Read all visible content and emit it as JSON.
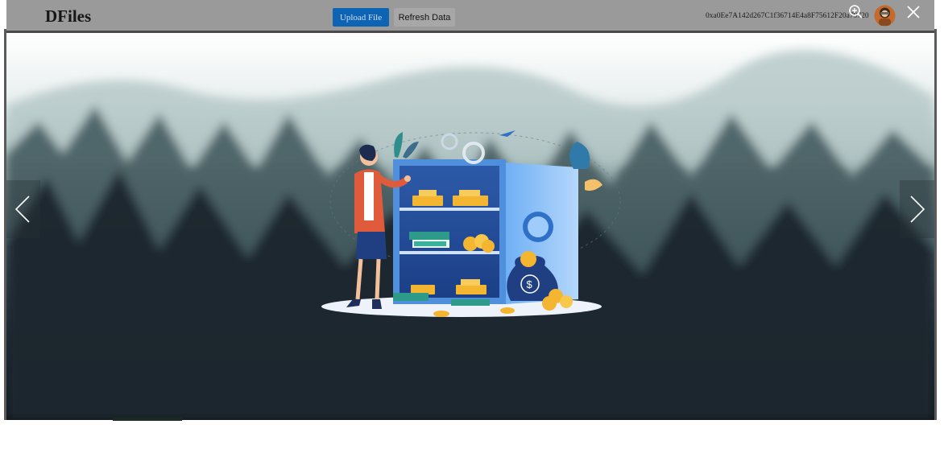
{
  "header": {
    "logo_text": "DFiles",
    "upload_label": "Upload File",
    "refresh_label": "Refresh Data",
    "wallet_address": "0xa0Ee7A142d267C1f36714E4a8F75612F20a79720"
  },
  "viewer": {
    "zoom_icon": "zoom-in-icon",
    "close_icon": "close-icon",
    "prev_icon": "chevron-left-icon",
    "next_icon": "chevron-right-icon",
    "image_subject": "illustration of woman presenting open vault with gold bars, cash and money bag"
  },
  "colors": {
    "header_bg": "#9a9a9a",
    "upload_button_bg": "#0d63b4",
    "refresh_button_bg": "#a7a7a7",
    "vault_blue": "#3f8ee8"
  }
}
